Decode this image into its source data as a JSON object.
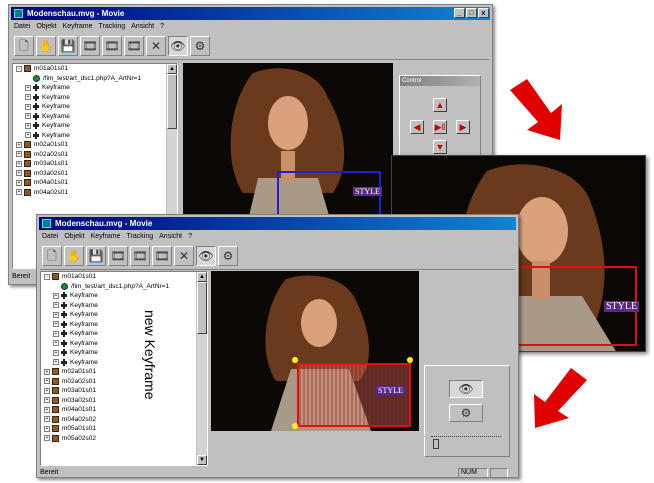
{
  "window1": {
    "title": "Modenschau.mvg - Movie",
    "title_buttons": [
      "_",
      "□",
      "x"
    ],
    "menu": [
      "Datei",
      "Objekt",
      "Keyframe",
      "Tracking",
      "Ansicht",
      "?"
    ],
    "tree": [
      {
        "label": "m01a01s01",
        "pm": "-",
        "icon": "cube",
        "indent": 0
      },
      {
        "label": "/fim_test/art_dsc1.php?A_ArtNr=1",
        "pm": "",
        "icon": "globe",
        "indent": 1
      },
      {
        "label": "Keyframe",
        "pm": "+",
        "icon": "film",
        "indent": 1
      },
      {
        "label": "Keyframe",
        "pm": "+",
        "icon": "film",
        "indent": 1
      },
      {
        "label": "Keyframe",
        "pm": "+",
        "icon": "film",
        "indent": 1
      },
      {
        "label": "Keyframe",
        "pm": "+",
        "icon": "film",
        "indent": 1
      },
      {
        "label": "Keyframe",
        "pm": "+",
        "icon": "film",
        "indent": 1
      },
      {
        "label": "Keyframe",
        "pm": "+",
        "icon": "film",
        "indent": 1
      },
      {
        "label": "m02a01s01",
        "pm": "+",
        "icon": "cube",
        "indent": 0
      },
      {
        "label": "m02a02s01",
        "pm": "+",
        "icon": "cube",
        "indent": 0
      },
      {
        "label": "m03a01s01",
        "pm": "+",
        "icon": "cube",
        "indent": 0
      },
      {
        "label": "m03a02s01",
        "pm": "+",
        "icon": "cube",
        "indent": 0
      },
      {
        "label": "m04a01s01",
        "pm": "+",
        "icon": "cube",
        "indent": 0
      },
      {
        "label": "m04a02s01",
        "pm": "+",
        "icon": "cube",
        "indent": 0
      }
    ],
    "status": "Bereit",
    "control_panel_title": "Control",
    "video_logo": "STYLE"
  },
  "window2": {
    "title": "Modenschau.mvg - Movie",
    "menu": [
      "Datei",
      "Objekt",
      "Keyframe",
      "Tracking",
      "Ansicht",
      "?"
    ],
    "tree": [
      {
        "label": "m01a01s01",
        "pm": "-",
        "icon": "cube",
        "indent": 0
      },
      {
        "label": "/fim_test/art_dsc1.php?A_ArtNr=1",
        "pm": "",
        "icon": "globe",
        "indent": 1
      },
      {
        "label": "Keyframe",
        "pm": "+",
        "icon": "film",
        "indent": 1
      },
      {
        "label": "Keyframe",
        "pm": "+",
        "icon": "film",
        "indent": 1
      },
      {
        "label": "Keyframe",
        "pm": "+",
        "icon": "film",
        "indent": 1
      },
      {
        "label": "Keyframe",
        "pm": "+",
        "icon": "film",
        "indent": 1
      },
      {
        "label": "Keyframe",
        "pm": "+",
        "icon": "film",
        "indent": 1
      },
      {
        "label": "Keyframe",
        "pm": "+",
        "icon": "film",
        "indent": 1
      },
      {
        "label": "Keyframe",
        "pm": "+",
        "icon": "film",
        "indent": 1
      },
      {
        "label": "Keyframe",
        "pm": "+",
        "icon": "film",
        "indent": 1
      },
      {
        "label": "m02a01s01",
        "pm": "+",
        "icon": "cube",
        "indent": 0
      },
      {
        "label": "m02a02s01",
        "pm": "+",
        "icon": "cube",
        "indent": 0
      },
      {
        "label": "m03a01s01",
        "pm": "+",
        "icon": "cube",
        "indent": 0
      },
      {
        "label": "m03a02s01",
        "pm": "+",
        "icon": "cube",
        "indent": 0
      },
      {
        "label": "m04a01s01",
        "pm": "+",
        "icon": "cube",
        "indent": 0
      },
      {
        "label": "m04a02s02",
        "pm": "+",
        "icon": "cube",
        "indent": 0
      },
      {
        "label": "m05a01s01",
        "pm": "+",
        "icon": "cube",
        "indent": 0
      },
      {
        "label": "m05a02s02",
        "pm": "+",
        "icon": "cube",
        "indent": 0
      }
    ],
    "status": "Bereit",
    "status_num": "NUM",
    "video_logo": "STYLE"
  },
  "annotation": {
    "text": "new Keyframe"
  },
  "zoom_view": {
    "logo": "STYLE"
  },
  "colors": {
    "highlight_box": "#e01010",
    "tracking_box": "#2020d0",
    "arrow": "#e00000",
    "title_active": "#000080"
  }
}
